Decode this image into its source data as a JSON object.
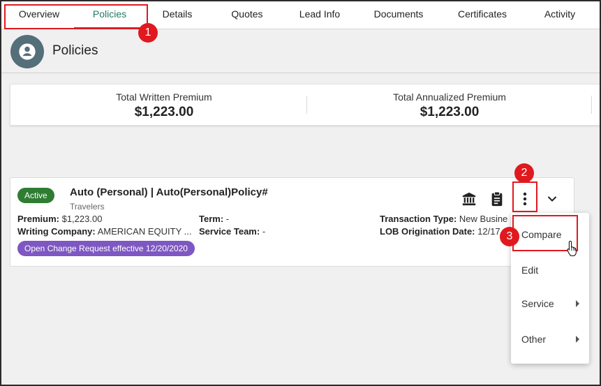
{
  "tabs": [
    {
      "label": "Overview"
    },
    {
      "label": "Policies"
    },
    {
      "label": "Details"
    },
    {
      "label": "Quotes"
    },
    {
      "label": "Lead Info"
    },
    {
      "label": "Documents"
    },
    {
      "label": "Certificates"
    },
    {
      "label": "Activity"
    }
  ],
  "active_tab": "Policies",
  "page": {
    "title": "Policies",
    "icon": "account-circle-icon"
  },
  "summary": {
    "written_label": "Total Written Premium",
    "written_value": "$1,223.00",
    "annualized_label": "Total Annualized Premium",
    "annualized_value": "$1,223.00"
  },
  "policy": {
    "status": "Active",
    "title": "Auto (Personal) | Auto(Personal)Policy#",
    "carrier": "Travelers",
    "premium_label": "Premium:",
    "premium_value": "$1,223.00",
    "writing_company_label": "Writing Company:",
    "writing_company_value": "AMERICAN EQUITY ...",
    "term_label": "Term:",
    "term_value": "-",
    "service_team_label": "Service Team:",
    "service_team_value": "-",
    "transaction_type_label": "Transaction Type:",
    "transaction_type_value": "New Busine",
    "lob_origination_label": "LOB Origination Date:",
    "lob_origination_value": "12/17",
    "change_request": "Open Change Request effective 12/20/2020",
    "icons": [
      "bank-icon",
      "clipboard-icon",
      "more-vert-icon",
      "chevron-down-icon"
    ]
  },
  "menu": {
    "items": [
      {
        "label": "Compare",
        "submenu": false
      },
      {
        "label": "Edit",
        "submenu": false
      },
      {
        "label": "Service",
        "submenu": true
      },
      {
        "label": "Other",
        "submenu": true
      }
    ]
  },
  "annotations": [
    {
      "number": "1"
    },
    {
      "number": "2"
    },
    {
      "number": "3"
    }
  ],
  "colors": {
    "accent": "#1f7a64",
    "active_badge": "#2e7d32",
    "change_pill": "#7e57c2",
    "annotation": "#e0191f",
    "avatar": "#546e7a"
  }
}
